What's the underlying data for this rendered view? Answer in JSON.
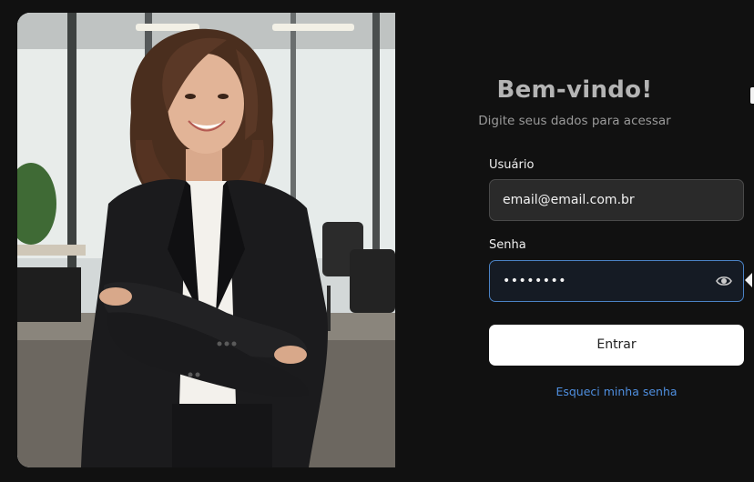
{
  "login": {
    "title": "Bem-vindo!",
    "subtitle": "Digite seus dados para acessar",
    "username_label": "Usuário",
    "username_value": "email@email.com.br",
    "password_label": "Senha",
    "password_value": "••••••••",
    "submit_label": "Entrar",
    "forgot_label": "Esqueci minha senha"
  },
  "icons": {
    "password_toggle": "eye-icon"
  },
  "colors": {
    "background": "#111111",
    "focus_border": "#4b82c4",
    "link": "#4f8fe0",
    "button_bg": "#ffffff"
  }
}
